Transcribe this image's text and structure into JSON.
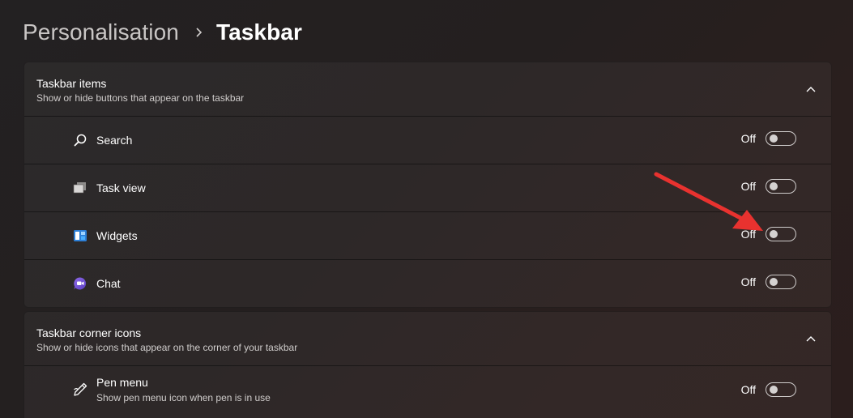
{
  "breadcrumb": {
    "parent": "Personalisation",
    "current": "Taskbar"
  },
  "sections": [
    {
      "title": "Taskbar items",
      "subtitle": "Show or hide buttons that appear on the taskbar",
      "items": [
        {
          "label": "Search",
          "icon": "search-icon",
          "state": "Off"
        },
        {
          "label": "Task view",
          "icon": "task-view-icon",
          "state": "Off"
        },
        {
          "label": "Widgets",
          "icon": "widgets-icon",
          "state": "Off"
        },
        {
          "label": "Chat",
          "icon": "chat-icon",
          "state": "Off"
        }
      ]
    },
    {
      "title": "Taskbar corner icons",
      "subtitle": "Show or hide icons that appear on the corner of your taskbar",
      "items": [
        {
          "label": "Pen menu",
          "description": "Show pen menu icon when pen is in use",
          "icon": "pen-icon",
          "state": "Off"
        }
      ]
    }
  ],
  "colors": {
    "annotation_arrow": "#e8322f",
    "chat_icon": "#7b5cd6",
    "widgets_icon": "#4ab0ff"
  }
}
